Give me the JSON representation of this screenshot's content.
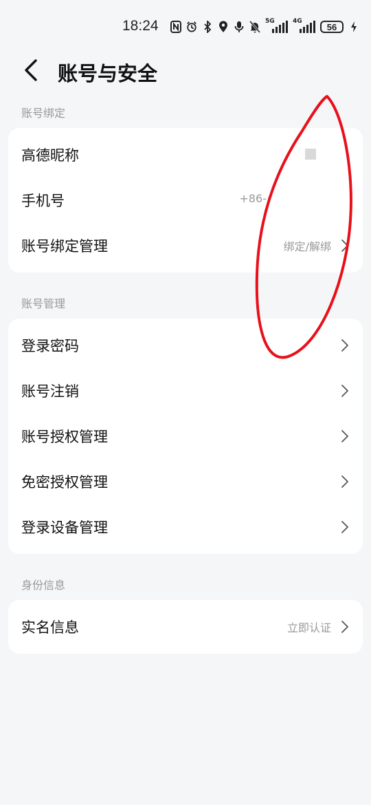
{
  "status_bar": {
    "time": "18:24",
    "network_1": "5G",
    "network_2": "4G",
    "battery": "56"
  },
  "header": {
    "title": "账号与安全"
  },
  "sections": {
    "binding": {
      "label": "账号绑定",
      "items": [
        {
          "label": "高德昵称",
          "value": ""
        },
        {
          "label": "手机号",
          "value": "+86-"
        },
        {
          "label": "账号绑定管理",
          "value": "绑定/解绑"
        }
      ]
    },
    "management": {
      "label": "账号管理",
      "items": [
        {
          "label": "登录密码"
        },
        {
          "label": "账号注销"
        },
        {
          "label": "账号授权管理"
        },
        {
          "label": "免密授权管理"
        },
        {
          "label": "登录设备管理"
        }
      ]
    },
    "identity": {
      "label": "身份信息",
      "items": [
        {
          "label": "实名信息",
          "value": "立即认证"
        }
      ]
    }
  },
  "colors": {
    "background": "#f5f6f8",
    "card": "#ffffff",
    "secondary_text": "#999999",
    "annotation": "#e8101a"
  }
}
